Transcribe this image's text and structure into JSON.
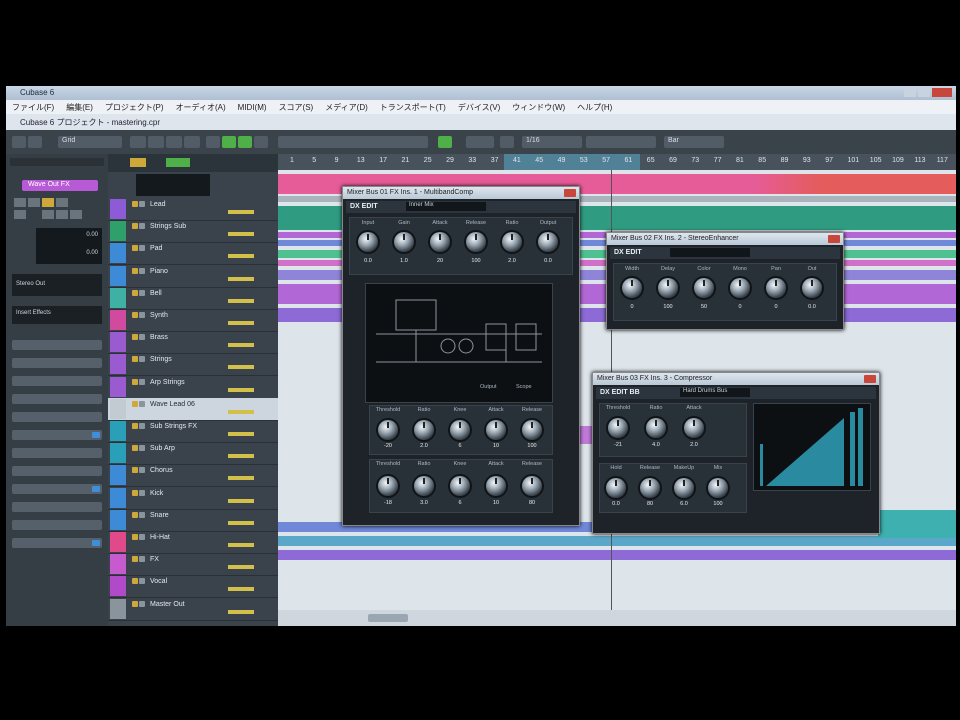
{
  "window": {
    "title": "Cubase 6",
    "menu": [
      "ファイル(F)",
      "編集(E)",
      "プロジェクト(P)",
      "オーディオ(A)",
      "MIDI(M)",
      "スコア(S)",
      "メディア(D)",
      "トランスポート(T)",
      "デバイス(V)",
      "ウィンドウ(W)",
      "ヘルプ(H)"
    ],
    "project_title": "Cubase 6 プロジェクト - mastering.cpr"
  },
  "toolbar": {
    "mode": "Grid",
    "quantize": "1/16",
    "snap": "Bar"
  },
  "ruler": {
    "bars": [
      "1",
      "5",
      "9",
      "13",
      "17",
      "21",
      "25",
      "29",
      "33",
      "37",
      "41",
      "45",
      "49",
      "53",
      "57",
      "61",
      "65",
      "69",
      "73",
      "77",
      "81",
      "85",
      "89",
      "93",
      "97",
      "101",
      "105",
      "109",
      "113",
      "117"
    ]
  },
  "inspector": {
    "track_label": "Wave Out FX",
    "output_label": "Stereo Out",
    "insert_label": "Insert Effects",
    "value_a": "0.00",
    "value_b": "0.00"
  },
  "tracks": [
    {
      "name": "Lead",
      "color": "#8e5bd6"
    },
    {
      "name": "Strings Sub",
      "color": "#30a06a"
    },
    {
      "name": "Pad",
      "color": "#3d8ad6"
    },
    {
      "name": "Piano",
      "color": "#3d8ad6"
    },
    {
      "name": "Bell",
      "color": "#3eb0a4"
    },
    {
      "name": "Synth",
      "color": "#d04aa0"
    },
    {
      "name": "Brass",
      "color": "#9a5ad0"
    },
    {
      "name": "Strings",
      "color": "#9a5ad0"
    },
    {
      "name": "Arp Strings",
      "color": "#9a5ad0"
    },
    {
      "name": "Wave Lead 06",
      "color": "#c2cbd2"
    },
    {
      "name": "Sub Strings FX",
      "color": "#2aa0b8"
    },
    {
      "name": "Sub Arp",
      "color": "#2aa0b8"
    },
    {
      "name": "Chorus",
      "color": "#3d8ad6"
    },
    {
      "name": "Kick",
      "color": "#3d8ad6"
    },
    {
      "name": "Snare",
      "color": "#3d8ad6"
    },
    {
      "name": "Hi-Hat",
      "color": "#e04a8a"
    },
    {
      "name": "FX",
      "color": "#c85ad0"
    },
    {
      "name": "Vocal",
      "color": "#b04ac8"
    },
    {
      "name": "Master Out",
      "color": "#8a949d"
    }
  ],
  "plugins": [
    {
      "title": "Mixer Bus 01 FX Ins. 1 - MultibandComp",
      "badge": "DX EDIT",
      "preset": "Inner Mix",
      "row1_labels": [
        "Input",
        "Gain",
        "Attack",
        "Release",
        "Ratio",
        "Output"
      ],
      "row1_values": [
        "0.0",
        "1.0",
        "20",
        "100",
        "2.0",
        "0.0"
      ],
      "graph_labels": [
        "Output",
        "Scope"
      ],
      "row2_labels": [
        "Threshold",
        "Ratio",
        "Knee",
        "Attack",
        "Release"
      ],
      "row2_values": [
        "-20",
        "2.0",
        "6",
        "10",
        "100"
      ],
      "row3_labels": [
        "Threshold",
        "Ratio",
        "Knee",
        "Attack",
        "Release"
      ],
      "row3_values": [
        "-18",
        "3.0",
        "6",
        "10",
        "80"
      ]
    },
    {
      "title": "Mixer Bus 02 FX Ins. 2 - StereoEnhancer",
      "badge": "DX EDIT",
      "preset": "",
      "labels": [
        "Width",
        "Delay",
        "Color",
        "Mono",
        "Pan",
        "Out"
      ],
      "values": [
        "0",
        "100",
        "50",
        "0",
        "0",
        "0.0"
      ]
    },
    {
      "title": "Mixer Bus 03 FX Ins. 3 - Compressor",
      "badge": "DX EDIT BB",
      "preset": "Hard Drums Bus",
      "row1_labels": [
        "Threshold",
        "Ratio",
        "Attack"
      ],
      "row1_values": [
        "-21",
        "4.0",
        "2.0"
      ],
      "row2_labels": [
        "Hold",
        "Release",
        "MakeUp",
        "Mix"
      ],
      "row2_values": [
        "0.0",
        "80",
        "6.0",
        "100"
      ]
    }
  ],
  "colors": {
    "pink": "#e0508e",
    "teal": "#2f9c82",
    "purple": "#b267d6",
    "blue": "#6f88d8",
    "green": "#4fb04a"
  }
}
